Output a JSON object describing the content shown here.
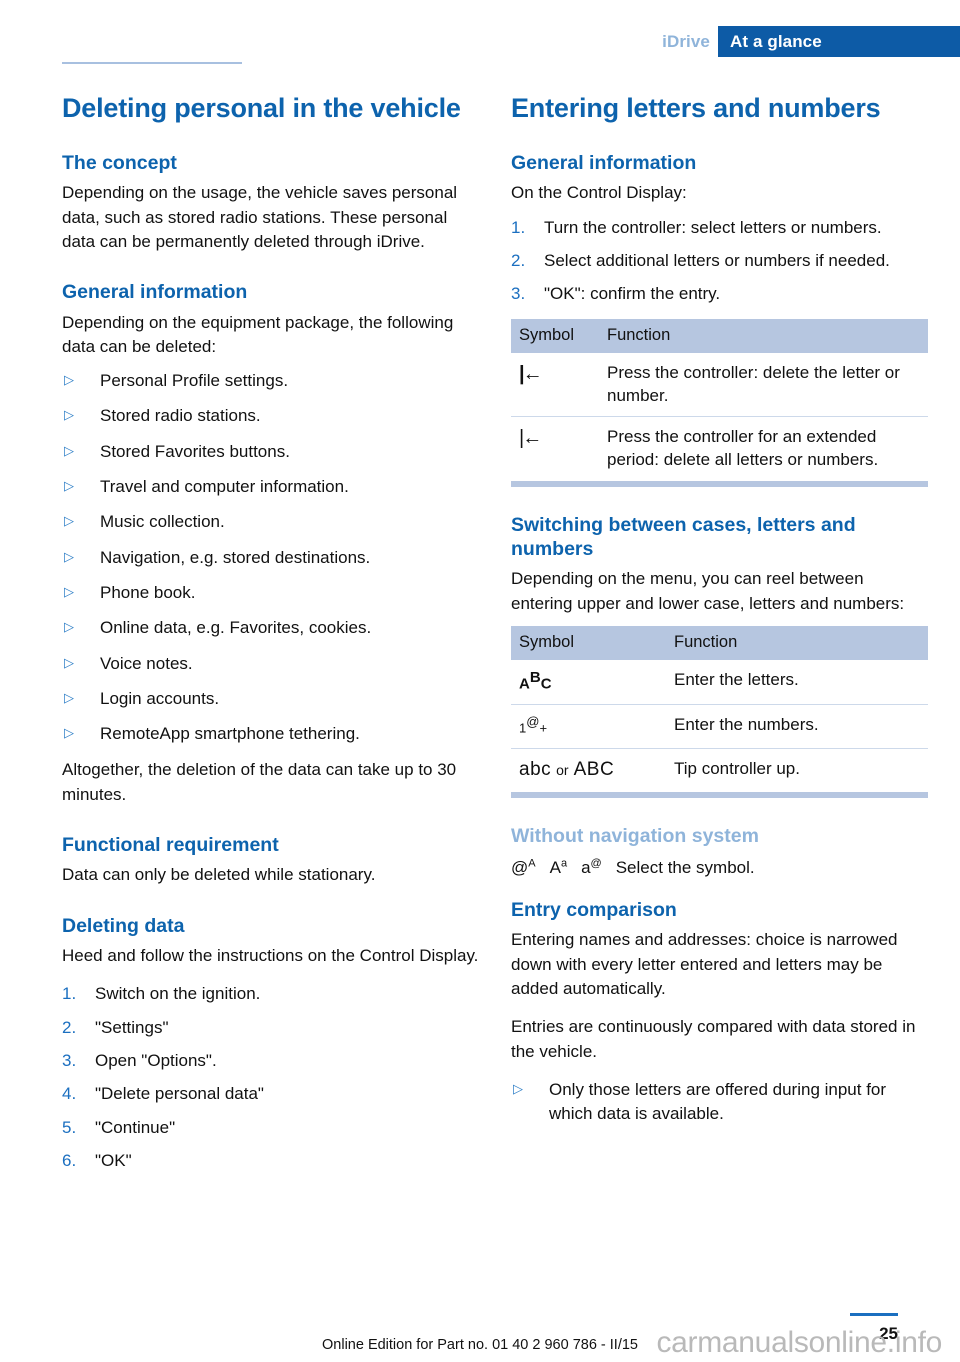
{
  "header": {
    "chapter": "iDrive",
    "section": "At a glance",
    "band_color": "#0d5ba6",
    "chapter_color": "#8fb4da"
  },
  "colors": {
    "heading_blue": "#0d63ad",
    "light_blue": "#8fb4da",
    "table_header_bg": "#b6c6e0",
    "marker_blue": "#1b6fc0"
  },
  "left_column": {
    "title": "Deleting personal in the vehicle",
    "sections": [
      {
        "heading": "The concept",
        "paragraph": "Depending on the usage, the vehicle saves personal data, such as stored radio stations. These personal data can be permanently deleted through iDrive."
      },
      {
        "heading": "General information",
        "paragraph": "Depending on the equipment package, the following data can be deleted:",
        "bullets": [
          "Personal Profile settings.",
          "Stored radio stations.",
          "Stored Favorites buttons.",
          "Travel and computer information.",
          "Music collection.",
          "Navigation, e.g. stored destinations.",
          "Phone book.",
          "Online data, e.g. Favorites, cookies.",
          "Voice notes.",
          "Login accounts.",
          "RemoteApp smartphone tethering."
        ],
        "closing": "Altogether, the deletion of the data can take up to 30 minutes."
      },
      {
        "heading": "Functional requirement",
        "paragraph": "Data can only be deleted while stationary."
      },
      {
        "heading": "Deleting data",
        "paragraph": "Heed and follow the instructions on the Control Display.",
        "steps": [
          {
            "num": "1.",
            "text": "Switch on the ignition."
          },
          {
            "num": "2.",
            "text": "\"Settings\""
          },
          {
            "num": "3.",
            "text": "Open \"Options\"."
          },
          {
            "num": "4.",
            "text": "\"Delete personal data\""
          },
          {
            "num": "5.",
            "text": "\"Continue\""
          },
          {
            "num": "6.",
            "text": "\"OK\""
          }
        ]
      }
    ]
  },
  "right_column": {
    "title": "Entering letters and numbers",
    "general_information": {
      "heading": "General information",
      "paragraph": "On the Control Display:",
      "steps": [
        {
          "num": "1.",
          "text": "Turn the controller: select letters or numbers."
        },
        {
          "num": "2.",
          "text": "Select additional letters or numbers if needed."
        },
        {
          "num": "3.",
          "text": "\"OK\": confirm the entry."
        }
      ]
    },
    "table_delete": {
      "columns": [
        "Symbol",
        "Function"
      ],
      "rows": [
        {
          "symbol": "|←",
          "symbol_name": "delete-character-icon",
          "function": "Press the controller: delete the letter or number."
        },
        {
          "symbol": "|←",
          "symbol_name": "delete-all-icon",
          "function": "Press the controller for an extended period: delete all letters or numbers."
        }
      ]
    },
    "switching": {
      "heading": "Switching between cases, letters and numbers",
      "paragraph": "Depending on the menu, you can reel between entering upper and lower case, letters and numbers:",
      "table": {
        "columns": [
          "Symbol",
          "Function"
        ],
        "rows": [
          {
            "symbol_main": "A",
            "symbol_sup": "B",
            "symbol_tail": "C",
            "symbol_name": "letters-abc-icon",
            "function": "Enter the letters."
          },
          {
            "symbol_main": "1",
            "symbol_sup": "@",
            "symbol_tail": "+",
            "symbol_name": "numbers-icon",
            "function": "Enter the numbers."
          },
          {
            "symbol_lower": "abc",
            "symbol_or": "or",
            "symbol_upper": "ABC",
            "symbol_name": "case-toggle-icon",
            "function": "Tip controller up."
          }
        ]
      }
    },
    "without_nav": {
      "heading": "Without navigation system",
      "symbols": [
        {
          "main": "@",
          "sup": "A",
          "name": "at-upper-icon"
        },
        {
          "main": "A",
          "sup": "a",
          "name": "upper-lower-icon"
        },
        {
          "main": "a",
          "sup": "@",
          "name": "lower-at-icon"
        }
      ],
      "text": "Select the symbol."
    },
    "entry_comparison": {
      "heading": "Entry comparison",
      "paragraph1": "Entering names and addresses: choice is narrowed down with every letter entered and letters may be added automatically.",
      "paragraph2": "Entries are continuously compared with data stored in the vehicle.",
      "bullets": [
        "Only those letters are offered during input for which data is available."
      ]
    }
  },
  "footer": {
    "edition": "Online Edition for Part no. 01 40 2 960 786 - II/15",
    "page_number": "25",
    "watermark": "carmanualsonline.info"
  }
}
